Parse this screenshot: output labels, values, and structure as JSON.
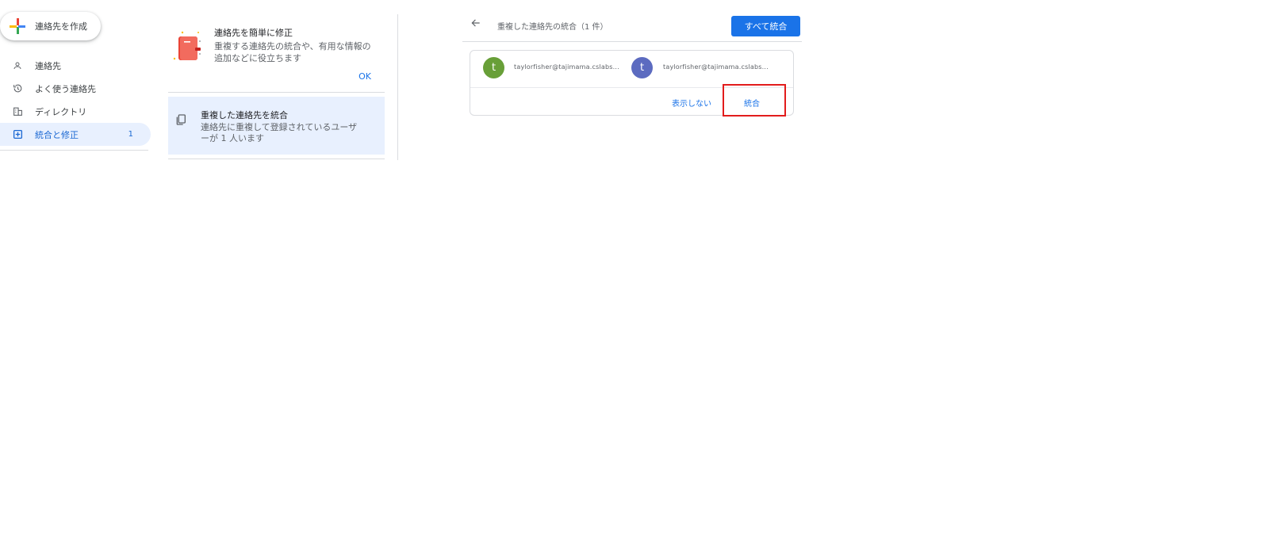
{
  "sidebar": {
    "create_label": "連絡先を作成",
    "items": [
      {
        "label": "連絡先",
        "icon": "person-icon"
      },
      {
        "label": "よく使う連絡先",
        "icon": "history-icon"
      },
      {
        "label": "ディレクトリ",
        "icon": "building-icon"
      },
      {
        "label": "統合と修正",
        "icon": "add-box-icon",
        "count": "1",
        "active": true
      }
    ]
  },
  "tip": {
    "title": "連絡先を簡単に修正",
    "description": "重複する連絡先の統合や、有用な情報の追加などに役立ちます",
    "ok_label": "OK"
  },
  "merge_card": {
    "title": "重複した連絡先を統合",
    "description": "連絡先に重複して登録されているユーザーが 1 人います"
  },
  "panel": {
    "title": "重複した連絡先の統合（1 件）",
    "merge_all_label": "すべて統合"
  },
  "duplicate": {
    "contacts": [
      {
        "initial": "t",
        "email": "taylorfisher@tajimama.cslabs...",
        "color": "#689f38"
      },
      {
        "initial": "t",
        "email": "taylorfisher@tajimama.cslabs...",
        "color": "#5c6bc0"
      }
    ],
    "dismiss_label": "表示しない",
    "merge_label": "統合"
  },
  "colors": {
    "accent": "#1a73e8",
    "active_bg": "#e8f0fe",
    "highlight": "#e21c1c"
  }
}
